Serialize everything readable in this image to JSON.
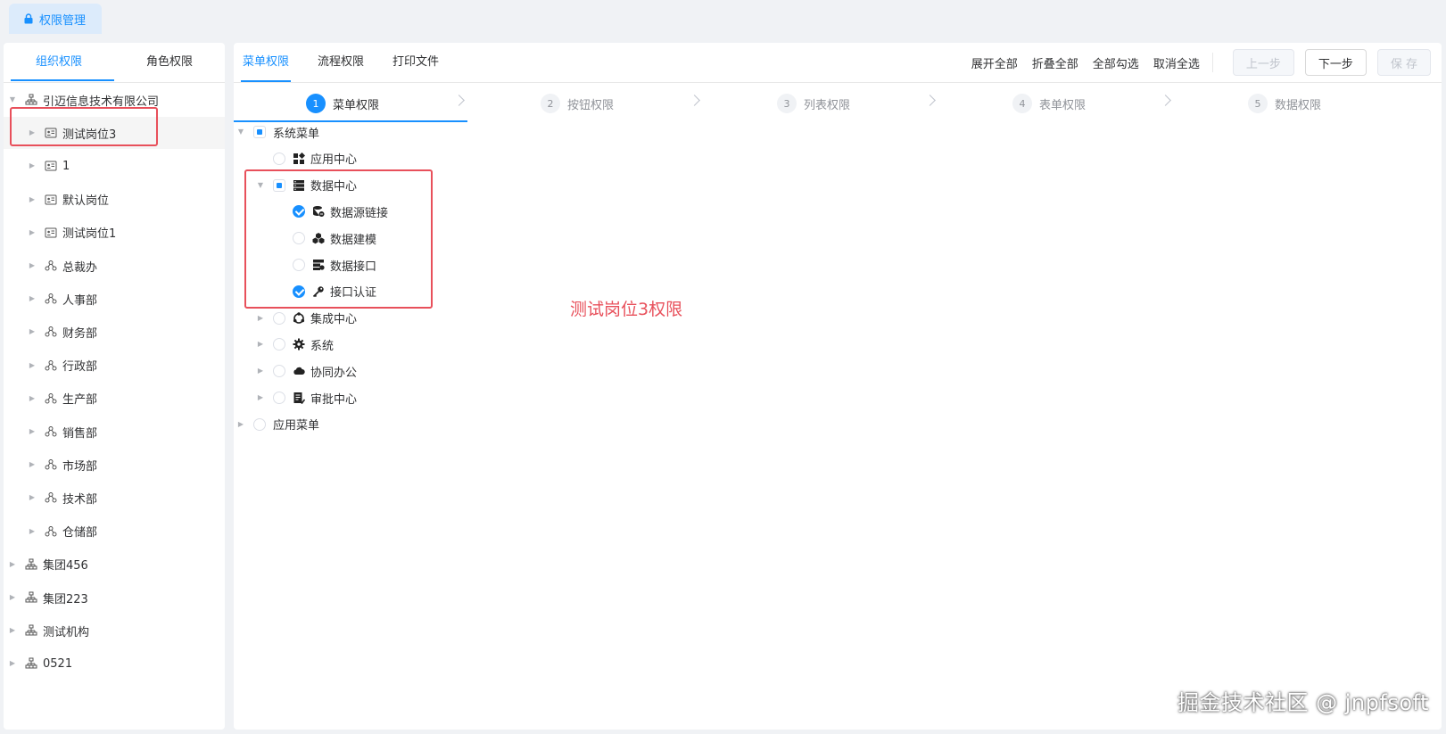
{
  "top_tab": {
    "label": "权限管理",
    "icon": "lock-icon"
  },
  "left": {
    "tabs": [
      "组织权限",
      "角色权限"
    ],
    "tree": [
      {
        "label": "引迈信息技术有限公司",
        "icon": "org-icon",
        "level": 0,
        "expanded": true
      },
      {
        "label": "测试岗位3",
        "icon": "position-icon",
        "level": 1,
        "selected": true
      },
      {
        "label": "1",
        "icon": "position-icon",
        "level": 1
      },
      {
        "label": "默认岗位",
        "icon": "position-icon",
        "level": 1
      },
      {
        "label": "测试岗位1",
        "icon": "position-icon",
        "level": 1
      },
      {
        "label": "总裁办",
        "icon": "dept-icon",
        "level": 1
      },
      {
        "label": "人事部",
        "icon": "dept-icon",
        "level": 1
      },
      {
        "label": "财务部",
        "icon": "dept-icon",
        "level": 1
      },
      {
        "label": "行政部",
        "icon": "dept-icon",
        "level": 1
      },
      {
        "label": "生产部",
        "icon": "dept-icon",
        "level": 1
      },
      {
        "label": "销售部",
        "icon": "dept-icon",
        "level": 1
      },
      {
        "label": "市场部",
        "icon": "dept-icon",
        "level": 1
      },
      {
        "label": "技术部",
        "icon": "dept-icon",
        "level": 1
      },
      {
        "label": "仓储部",
        "icon": "dept-icon",
        "level": 1
      },
      {
        "label": "集团456",
        "icon": "org-icon",
        "level": 0
      },
      {
        "label": "集团223",
        "icon": "org-icon",
        "level": 0
      },
      {
        "label": "测试机构",
        "icon": "org-icon",
        "level": 0
      },
      {
        "label": "0521",
        "icon": "org-icon",
        "level": 0
      }
    ]
  },
  "main": {
    "tabs": [
      "菜单权限",
      "流程权限",
      "打印文件"
    ],
    "actions": [
      "展开全部",
      "折叠全部",
      "全部勾选",
      "取消全选"
    ],
    "buttons": {
      "prev": "上一步",
      "next": "下一步",
      "save": "保 存"
    },
    "steps": [
      {
        "num": "1",
        "label": "菜单权限"
      },
      {
        "num": "2",
        "label": "按钮权限"
      },
      {
        "num": "3",
        "label": "列表权限"
      },
      {
        "num": "4",
        "label": "表单权限"
      },
      {
        "num": "5",
        "label": "数据权限"
      }
    ],
    "perm_tree": [
      {
        "label": "系统菜单",
        "level": 0,
        "state": "indeterminate",
        "expanded": true,
        "icon": ""
      },
      {
        "label": "应用中心",
        "level": 1,
        "state": "unchecked",
        "icon": "grid-icon"
      },
      {
        "label": "数据中心",
        "level": 1,
        "state": "indeterminate",
        "expanded": true,
        "icon": "server-icon"
      },
      {
        "label": "数据源链接",
        "level": 2,
        "state": "checked",
        "icon": "database-link-icon"
      },
      {
        "label": "数据建模",
        "level": 2,
        "state": "unchecked",
        "icon": "cubes-icon"
      },
      {
        "label": "数据接口",
        "level": 2,
        "state": "unchecked",
        "icon": "api-icon"
      },
      {
        "label": "接口认证",
        "level": 2,
        "state": "checked",
        "icon": "key-icon"
      },
      {
        "label": "集成中心",
        "level": 1,
        "state": "unchecked",
        "icon": "integration-icon"
      },
      {
        "label": "系统",
        "level": 1,
        "state": "unchecked",
        "icon": "gear-icon"
      },
      {
        "label": "协同办公",
        "level": 1,
        "state": "unchecked",
        "icon": "cloud-icon"
      },
      {
        "label": "审批中心",
        "level": 1,
        "state": "unchecked",
        "icon": "approval-icon"
      },
      {
        "label": "应用菜单",
        "level": 0,
        "state": "unchecked",
        "icon": ""
      }
    ],
    "annotation": "测试岗位3权限"
  },
  "watermark": "掘金技术社区 @ jnpfsoft",
  "colors": {
    "accent": "#1890ff",
    "annotation_red": "#e8505b"
  }
}
